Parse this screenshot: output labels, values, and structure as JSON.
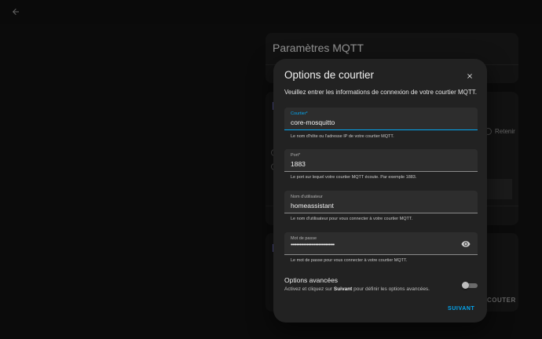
{
  "background": {
    "title": "Paramètres MQTT",
    "retain_label": "Retenir",
    "listen_label": "COUTER"
  },
  "dialog": {
    "title": "Options de courtier",
    "description": "Veuillez entrer les informations de connexion de votre courtier MQTT.",
    "fields": [
      {
        "label": "Courtier*",
        "value": "core-mosquitto",
        "helper": "Le nom d'hôte ou l'adresse IP de votre courtier MQTT."
      },
      {
        "label": "Port*",
        "value": "1883",
        "helper": "Le port sur lequel votre courtier MQTT écoute. Par exemple 1883."
      },
      {
        "label": "Nom d'utilisateur",
        "value": "homeassistant",
        "helper": "Le nom d'utilisateur pour vous connecter à votre courtier MQTT."
      },
      {
        "label": "Mot de passe",
        "value": "••••••••••••••••••••••••••••••",
        "helper": "Le mot de passe pour vous connecter à votre courtier MQTT."
      }
    ],
    "advanced": {
      "title": "Options avancées",
      "desc_before": "Activez et cliquez sur ",
      "desc_bold": "Suivant",
      "desc_after": " pour définir les options avancées.",
      "enabled": false
    },
    "next_label": "SUIVANT"
  },
  "colors": {
    "accent": "#03a9f4",
    "dialog_bg": "#222222",
    "page_bg": "#111111"
  },
  "icons": {
    "back": "arrow-left-icon",
    "close": "close-icon",
    "password": "eye-icon"
  }
}
